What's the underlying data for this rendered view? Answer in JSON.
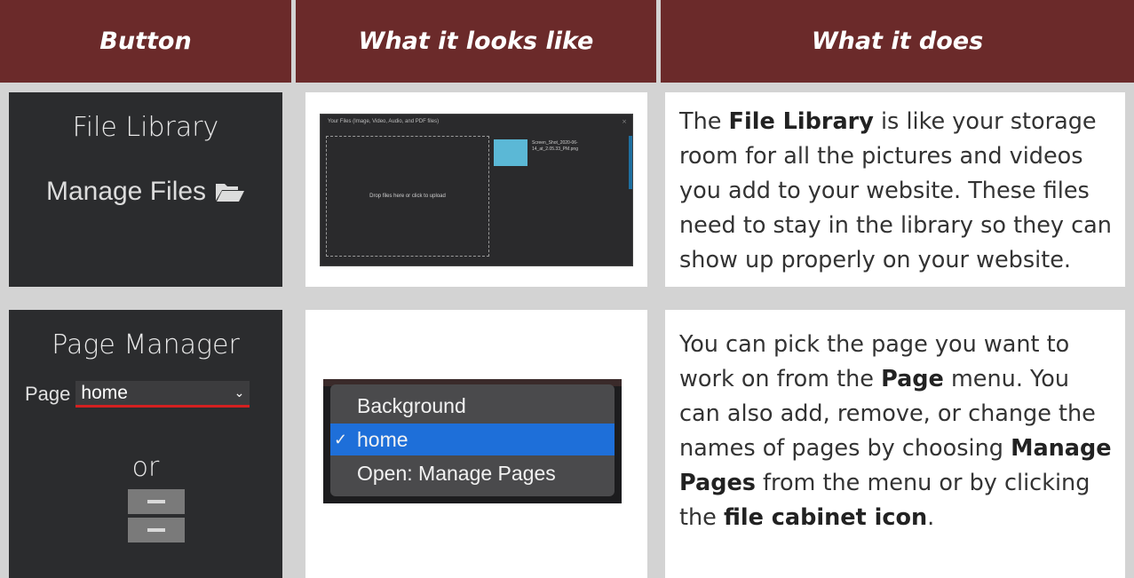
{
  "headers": [
    "Button",
    "What it looks like",
    "What it does"
  ],
  "file_library": {
    "title": "File Library",
    "button_label": "Manage Files",
    "preview": {
      "dialog_title": "Your Files (Image, Video, Audio, and PDF files)",
      "close": "×",
      "drop_text": "Drop files here or click to upload",
      "file_name": "Screen_Shot_2020-06-14_at_2.05.33_PM.png"
    },
    "description": {
      "p1": "The ",
      "b1": "File Library",
      "p2": " is like your storage room for all the pictures and videos you add to your website. These files need to stay in the library so they can show up properly on your website."
    }
  },
  "page_manager": {
    "title": "Page Manager",
    "page_label": "Page",
    "selected_page": "home",
    "or_text": "or",
    "preview": {
      "items": [
        "Background",
        "home",
        "Open: Manage Pages"
      ],
      "selected_index": 1,
      "check": "✓"
    },
    "description": {
      "p1": "You can pick the page you want to work on from the ",
      "b1": "Page",
      "p2": " menu. You can also add, remove, or change the names of pages by choosing ",
      "b2": "Manage Pages",
      "p3": " from the menu or by clicking the ",
      "b3": "file cabinet icon",
      "p4": "."
    }
  },
  "colors": {
    "header": "#6b2a2a",
    "dark_panel": "#2b2c2e",
    "select_underline": "#d42020",
    "menu_selected": "#1e6fd9"
  }
}
